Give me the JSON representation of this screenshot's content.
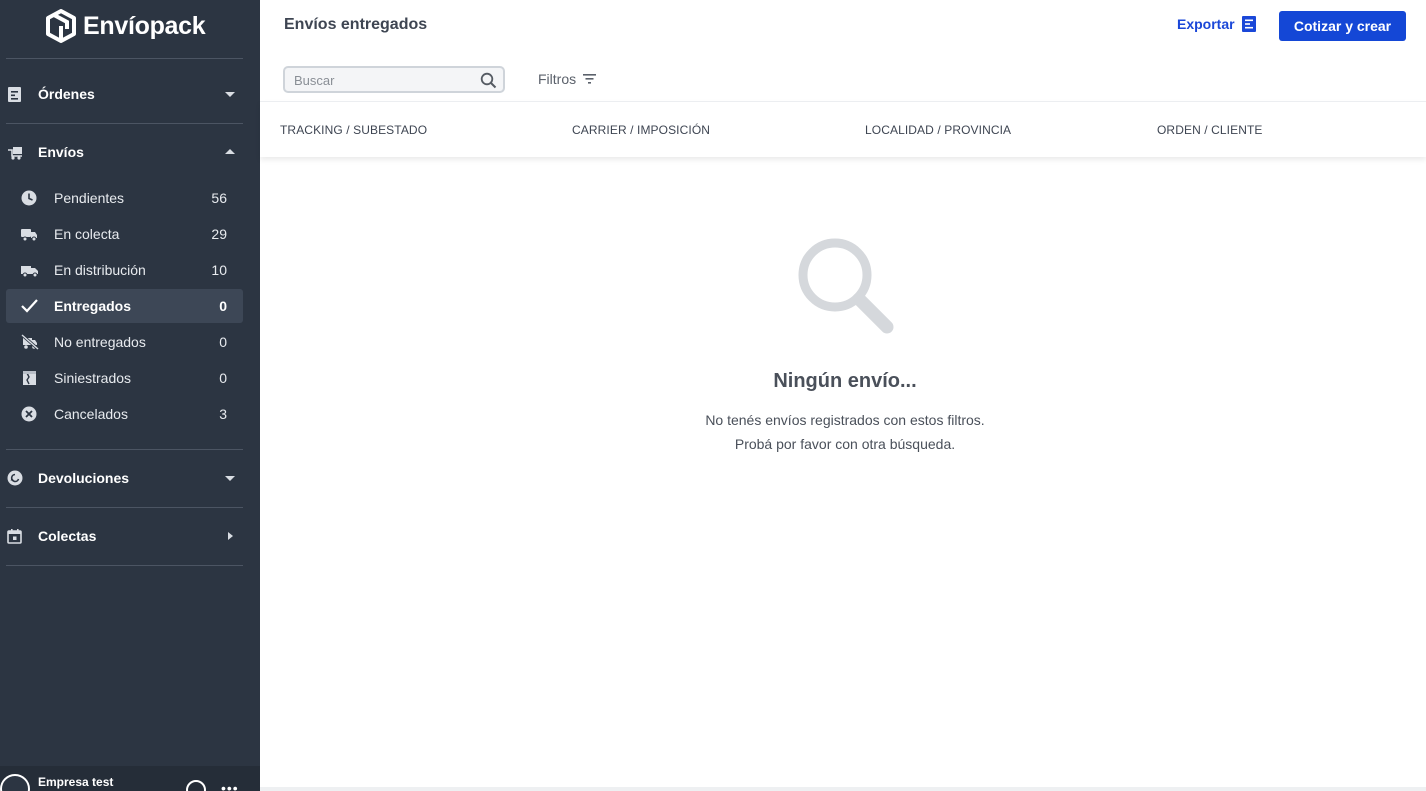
{
  "app": {
    "brand": "Envíopack"
  },
  "sidebar": {
    "sections": {
      "ordenes": {
        "label": "Órdenes",
        "icon": "document-icon",
        "state": "collapsed"
      },
      "envios": {
        "label": "Envíos",
        "icon": "truck-box-icon",
        "state": "expanded"
      },
      "devoluciones": {
        "label": "Devoluciones",
        "icon": "return-icon",
        "state": "collapsed"
      },
      "colectas": {
        "label": "Colectas",
        "icon": "calendar-icon",
        "state": "collapsed"
      }
    },
    "envios_items": [
      {
        "label": "Pendientes",
        "count": "56",
        "icon": "clock-icon"
      },
      {
        "label": "En colecta",
        "count": "29",
        "icon": "pickup-truck-icon"
      },
      {
        "label": "En distribución",
        "count": "10",
        "icon": "delivery-truck-icon"
      },
      {
        "label": "Entregados",
        "count": "0",
        "icon": "check-icon",
        "active": true
      },
      {
        "label": "No entregados",
        "count": "0",
        "icon": "truck-crossed-icon"
      },
      {
        "label": "Siniestrados",
        "count": "0",
        "icon": "damaged-box-icon"
      },
      {
        "label": "Cancelados",
        "count": "3",
        "icon": "cancel-circle-icon"
      }
    ],
    "footer": {
      "company": "Empresa test"
    }
  },
  "header": {
    "title": "Envíos entregados",
    "export_label": "Exportar",
    "primary_label": "Cotizar y crear"
  },
  "toolbar": {
    "search_placeholder": "Buscar",
    "search_value": "",
    "filters_label": "Filtros"
  },
  "table": {
    "columns": [
      "TRACKING / SUBESTADO",
      "CARRIER / IMPOSICIÓN",
      "LOCALIDAD / PROVINCIA",
      "ORDEN / CLIENTE"
    ]
  },
  "empty_state": {
    "title": "Ningún envío...",
    "line1": "No tenés envíos registrados con estos filtros.",
    "line2": "Probá por favor con otra búsqueda."
  },
  "colors": {
    "sidebar_bg": "#2c3542",
    "accent": "#1447d6",
    "link": "#1a47d8",
    "empty_icon": "#d5d8dc"
  }
}
